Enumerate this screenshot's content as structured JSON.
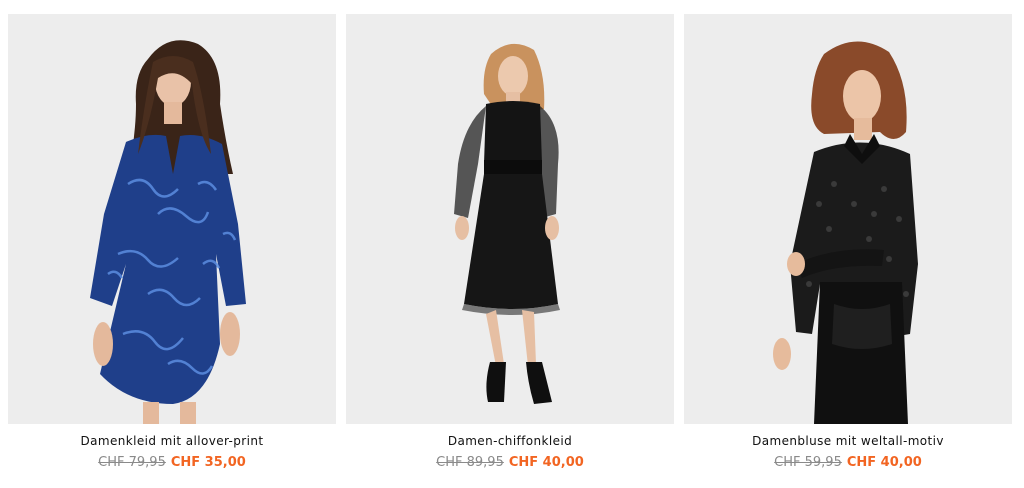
{
  "products": [
    {
      "name": "Damenkleid mit allover-print",
      "old_price": "CHF 79,95",
      "new_price": "CHF 35,00",
      "image": "woman-blue-patterned-dress"
    },
    {
      "name": "Damen-chiffonkleid",
      "old_price": "CHF 89,95",
      "new_price": "CHF 40,00",
      "image": "woman-black-chiffon-dress"
    },
    {
      "name": "Damenbluse mit weltall-motiv",
      "old_price": "CHF 59,95",
      "new_price": "CHF 40,00",
      "image": "woman-black-blouse-leather-skirt"
    }
  ],
  "colors": {
    "sale": "#f26522",
    "old_price": "#8a8a8a",
    "photo_bg": "#ededed",
    "text": "#111111"
  }
}
